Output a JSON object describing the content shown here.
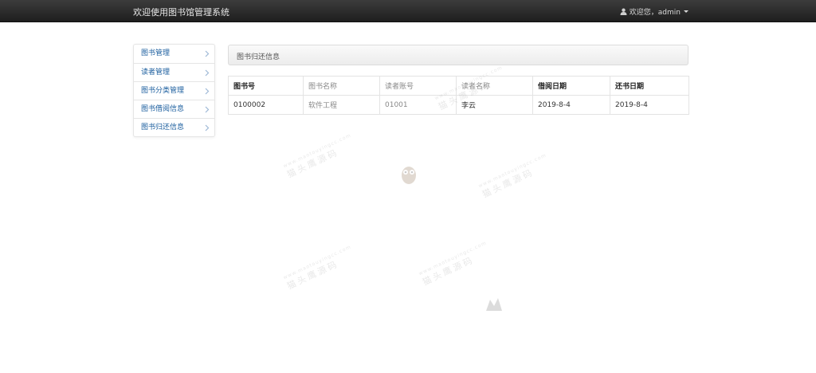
{
  "navbar": {
    "title": "欢迎使用图书馆管理系统",
    "greeting": "欢迎您，",
    "username": "admin"
  },
  "sidebar": {
    "items": [
      {
        "label": "图书管理"
      },
      {
        "label": "读者管理"
      },
      {
        "label": "图书分类管理"
      },
      {
        "label": "图书借阅信息"
      },
      {
        "label": "图书归还信息"
      }
    ]
  },
  "panel": {
    "title": "图书归还信息"
  },
  "table": {
    "headers": [
      "图书号",
      "图书名称",
      "读者账号",
      "读者名称",
      "借阅日期",
      "还书日期"
    ],
    "rows": [
      [
        "0100002",
        "软件工程",
        "01001",
        "李云",
        "2019-8-4",
        "2019-8-4"
      ]
    ]
  },
  "watermark": {
    "text": "猫头鹰源码",
    "url": "www.maotouyingcc.com"
  },
  "colors": {
    "navbar_bg": "#2b2b2b",
    "link": "#1a5d9e",
    "border": "#e3e3e3"
  }
}
